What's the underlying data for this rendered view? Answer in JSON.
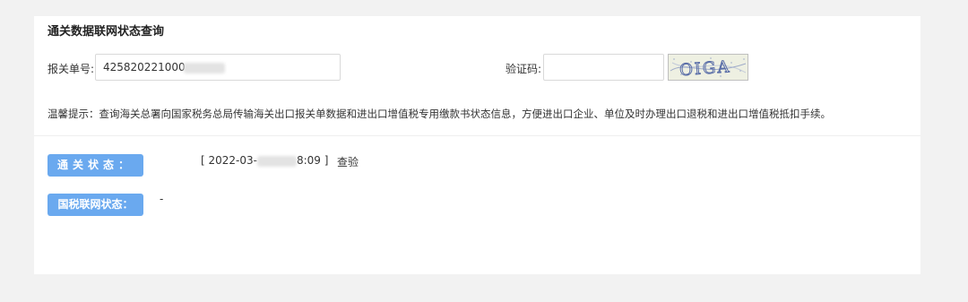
{
  "page": {
    "title": "通关数据联网状态查询"
  },
  "form": {
    "declaration_label": "报关单号:",
    "declaration_value": "425820221000",
    "captcha_label": "验证码:",
    "captcha_input_value": "",
    "captcha_image_text": "OIGA"
  },
  "notice": {
    "text": "温馨提示：查询海关总署向国家税务总局传输海关出口报关单数据和进出口增值税专用缴款书状态信息，方便进出口企业、单位及时办理出口退税和进出口增值税抵扣手续。"
  },
  "status": {
    "customs_label": "通关状态：",
    "customs_time_prefix": "[ 2022-03-",
    "customs_time_suffix": "8:09 ]",
    "customs_result": "查验",
    "tax_label": "国税联网状态：",
    "tax_value": "-"
  },
  "colors": {
    "pill_blue": "#6aa9ef",
    "background": "#f2f2f2",
    "card": "#ffffff"
  }
}
